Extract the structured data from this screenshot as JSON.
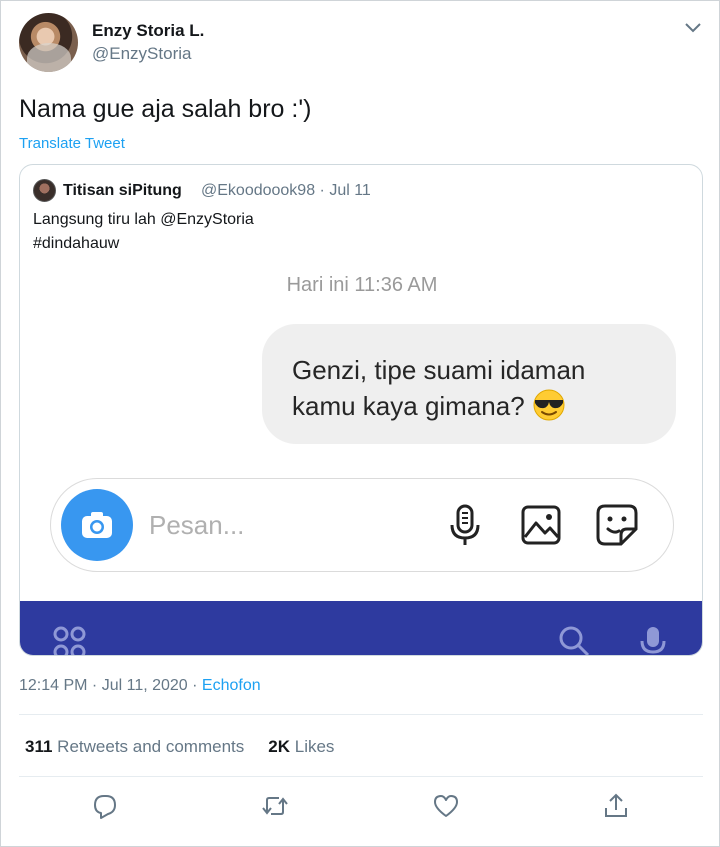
{
  "author": {
    "name": "Enzy Storia L.",
    "handle": "@EnzyStoria"
  },
  "tweet": {
    "text": "Nama gue aja salah bro :')",
    "translate_label": "Translate Tweet"
  },
  "quoted": {
    "name": "Titisan siPitung",
    "meta": "@Ekoodoook98 · Jul 11",
    "line1": "Langsung tiru lah @EnzyStoria",
    "line2": "#dindahauw",
    "screenshot": {
      "chat_time": "Hari ini 11:36 AM",
      "bubble_line1": "Genzi,  tipe suami idaman",
      "bubble_line2": "kamu kaya gimana?",
      "composer_placeholder": "Pesan..."
    }
  },
  "footer": {
    "timestamp": "12:14 PM · Jul 11, 2020 · ",
    "source": "Echofon",
    "retweets_count": "311",
    "retweets_label": "Retweets and comments",
    "likes_count": "2K",
    "likes_label": "Likes"
  },
  "icons": {
    "reply": "reply-icon",
    "retweet": "retweet-icon",
    "like": "heart-icon",
    "share": "share-icon",
    "camera": "camera-icon",
    "mic": "microphone-icon",
    "image": "image-icon",
    "sticker": "sticker-icon",
    "caret": "chevron-down-icon"
  },
  "colors": {
    "link": "#1da1f2",
    "secondary_text": "#657786",
    "camera_button": "#3897f0",
    "navbar": "#2e3a9f"
  }
}
